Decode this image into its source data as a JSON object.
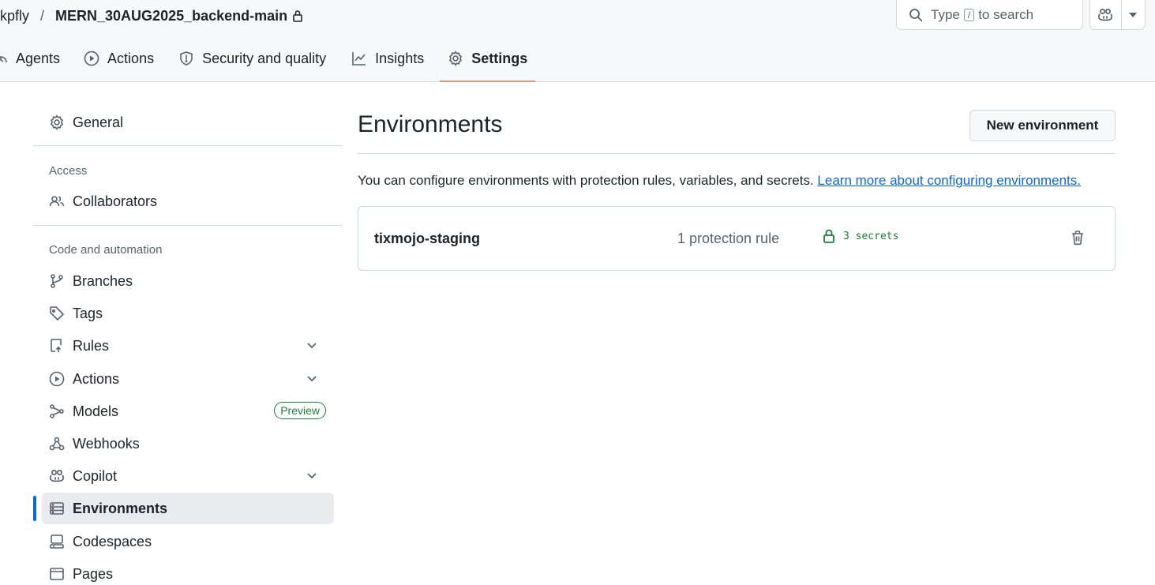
{
  "header": {
    "owner": "kpfly",
    "separator": "/",
    "repo": "MERN_30AUG2025_backend-main",
    "search_prefix": "Type",
    "search_key": "/",
    "search_suffix": "to search"
  },
  "tabs": [
    {
      "label": "Agents",
      "icon": "agent-icon"
    },
    {
      "label": "Actions",
      "icon": "play-icon"
    },
    {
      "label": "Security and quality",
      "icon": "shield-icon"
    },
    {
      "label": "Insights",
      "icon": "graph-icon"
    },
    {
      "label": "Settings",
      "icon": "gear-icon",
      "active": true
    }
  ],
  "sidebar": {
    "general": "General",
    "access_heading": "Access",
    "collaborators": "Collaborators",
    "code_heading": "Code and automation",
    "branches": "Branches",
    "tags": "Tags",
    "rules": "Rules",
    "actions": "Actions",
    "models": "Models",
    "models_badge": "Preview",
    "webhooks": "Webhooks",
    "copilot": "Copilot",
    "environments": "Environments",
    "codespaces": "Codespaces",
    "pages": "Pages"
  },
  "main": {
    "title": "Environments",
    "new_button": "New environment",
    "description": "You can configure environments with protection rules, variables, and secrets.",
    "learn_more": "Learn more about configuring environments.",
    "environments": [
      {
        "name": "tixmojo-staging",
        "rules": "1 protection rule",
        "secrets": "3 secrets"
      }
    ]
  },
  "colors": {
    "accent": "#0969da",
    "active_tab_underline": "#fd8c73",
    "success": "#1a7f37"
  }
}
